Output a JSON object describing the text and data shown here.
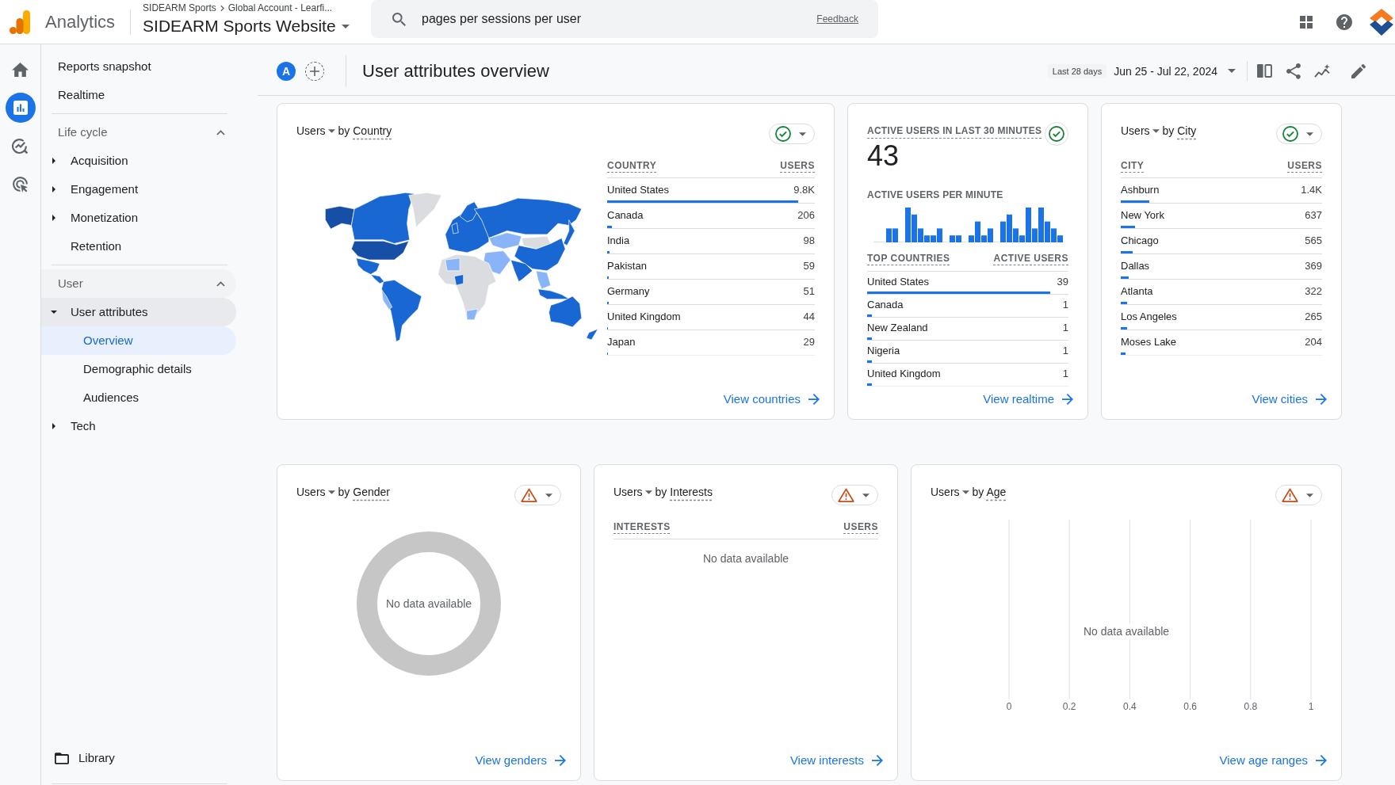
{
  "top_bar": {
    "product": "Analytics",
    "breadcrumb": [
      "SIDEARM Sports",
      "Global Account - Learfi..."
    ],
    "property": "SIDEARM Sports Website",
    "search": {
      "value": "pages per sessions per user"
    },
    "feedback": "Feedback"
  },
  "rail": [
    {
      "kind": "home",
      "selected": false
    },
    {
      "kind": "reports",
      "selected": true
    },
    {
      "kind": "explore",
      "selected": false
    },
    {
      "kind": "advertising",
      "selected": false
    }
  ],
  "nav": {
    "items": [
      {
        "label": "Reports snapshot",
        "selected": false
      },
      {
        "label": "Realtime",
        "selected": false
      }
    ],
    "sections": [
      {
        "label": "Life cycle",
        "expanded": true,
        "items": [
          {
            "label": "Acquisition",
            "expanded": false,
            "selected": false
          },
          {
            "label": "Engagement",
            "expanded": false,
            "selected": false
          },
          {
            "label": "Monetization",
            "expanded": false,
            "selected": false
          },
          {
            "label": "Retention",
            "selected": false
          }
        ]
      },
      {
        "label": "User",
        "expanded": true,
        "items": [
          {
            "label": "User attributes",
            "expanded": true,
            "selected": false,
            "children": [
              {
                "label": "Overview",
                "selected": true
              },
              {
                "label": "Demographic details",
                "selected": false
              },
              {
                "label": "Audiences",
                "selected": false
              }
            ]
          },
          {
            "label": "Tech",
            "expanded": false,
            "selected": false
          }
        ]
      }
    ],
    "library": "Library"
  },
  "header": {
    "comparison": "A",
    "title": "User attributes overview",
    "range_label": "Last 28 days",
    "date_range": "Jun 25 - Jul 22, 2024"
  },
  "cards_top": [
    {
      "kind": "map_table",
      "metric": "Users",
      "joiner": "by",
      "dimension": "Country",
      "warning": false,
      "columns": [
        "COUNTRY",
        "USERS"
      ],
      "rows": [
        {
          "label": "United States",
          "value": "9.8K",
          "level": 0.92
        },
        {
          "label": "Canada",
          "value": "206",
          "level": 0.023
        },
        {
          "label": "India",
          "value": "98",
          "level": 0.012
        },
        {
          "label": "Pakistan",
          "value": "59",
          "level": 0.008
        },
        {
          "label": "Germany",
          "value": "51",
          "level": 0.006
        },
        {
          "label": "United Kingdom",
          "value": "44",
          "level": 0.005
        },
        {
          "label": "Japan",
          "value": "29",
          "level": 0.004
        }
      ],
      "link": "View countries"
    },
    {
      "kind": "realtime",
      "title": "ACTIVE USERS IN LAST 30 MINUTES",
      "warning": false,
      "count": "43",
      "subtitle": "ACTIVE USERS PER MINUTE",
      "columns": [
        "TOP COUNTRIES",
        "ACTIVE USERS"
      ],
      "rows": [
        {
          "label": "United States",
          "value": "39",
          "level": 0.91
        },
        {
          "label": "Canada",
          "value": "1",
          "level": 0.024
        },
        {
          "label": "New Zealand",
          "value": "1",
          "level": 0.024
        },
        {
          "label": "Nigeria",
          "value": "1",
          "level": 0.024
        },
        {
          "label": "United Kingdom",
          "value": "1",
          "level": 0.024
        }
      ],
      "link": "View realtime"
    },
    {
      "kind": "table",
      "metric": "Users",
      "joiner": "by",
      "dimension": "City",
      "warning": false,
      "columns": [
        "CITY",
        "USERS"
      ],
      "rows": [
        {
          "label": "Ashburn",
          "value": "1.4K",
          "level": 0.14
        },
        {
          "label": "New York",
          "value": "637",
          "level": 0.07
        },
        {
          "label": "Chicago",
          "value": "565",
          "level": 0.06
        },
        {
          "label": "Dallas",
          "value": "369",
          "level": 0.04
        },
        {
          "label": "Atlanta",
          "value": "322",
          "level": 0.033
        },
        {
          "label": "Los Angeles",
          "value": "265",
          "level": 0.03
        },
        {
          "label": "Moses Lake",
          "value": "204",
          "level": 0.022
        }
      ],
      "link": "View cities"
    }
  ],
  "cards_bottom": [
    {
      "kind": "donut",
      "metric": "Users",
      "joiner": "by",
      "dimension": "Gender",
      "warning": true,
      "empty_text": "No data available",
      "link": "View genders"
    },
    {
      "kind": "table",
      "metric": "Users",
      "joiner": "by",
      "dimension": "Interests",
      "warning": true,
      "columns": [
        "INTERESTS",
        "USERS"
      ],
      "empty_text": "No data available",
      "link": "View interests"
    },
    {
      "kind": "axis",
      "metric": "Users",
      "joiner": "by",
      "dimension": "Age",
      "warning": true,
      "axis_labels": [
        "0",
        "0.2",
        "0.4",
        "0.6",
        "0.8",
        "1"
      ],
      "empty_text": "No data available",
      "link": "View age ranges"
    }
  ]
}
